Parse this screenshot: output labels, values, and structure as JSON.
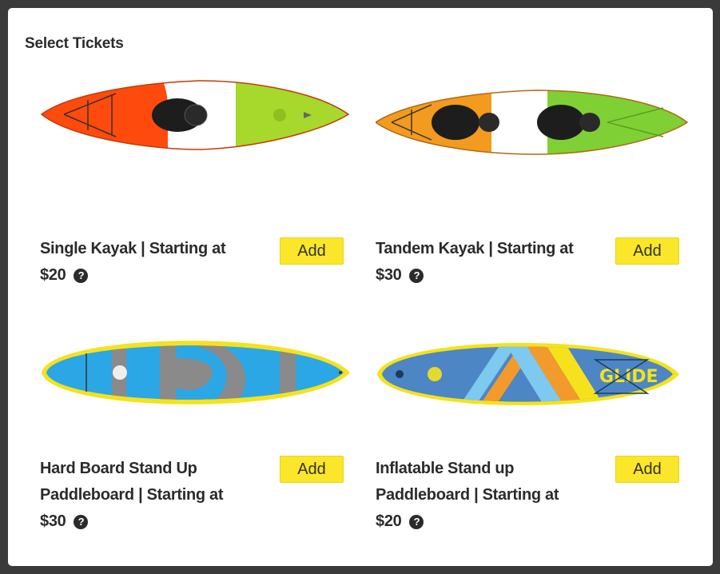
{
  "modal": {
    "title": "Select Tickets"
  },
  "tickets": [
    {
      "name": "Single Kayak | Starting at",
      "price": "$20",
      "add_label": "Add",
      "help_icon": "question-circle-icon",
      "colors": [
        "#ff4a0e",
        "#ffffff",
        "#a6d92b"
      ]
    },
    {
      "name": "Tandem Kayak | Starting at",
      "price": "$30",
      "add_label": "Add",
      "help_icon": "question-circle-icon",
      "colors": [
        "#f29b1e",
        "#ffffff",
        "#7fd035"
      ]
    },
    {
      "name": "Hard Board Stand Up Paddleboard | Starting at",
      "price": "$30",
      "add_label": "Add",
      "help_icon": "question-circle-icon",
      "colors": [
        "#f5e21c",
        "#2ba7e6",
        "#8a8a8a"
      ]
    },
    {
      "name": "Inflatable Stand up Paddleboard | Starting at",
      "price": "$20",
      "add_label": "Add",
      "help_icon": "question-circle-icon",
      "brand": "GLIDE",
      "colors": [
        "#f5e21c",
        "#4d86c4",
        "#f39a2c",
        "#7ec9ef"
      ]
    }
  ],
  "accent_color": "#fbe62a"
}
